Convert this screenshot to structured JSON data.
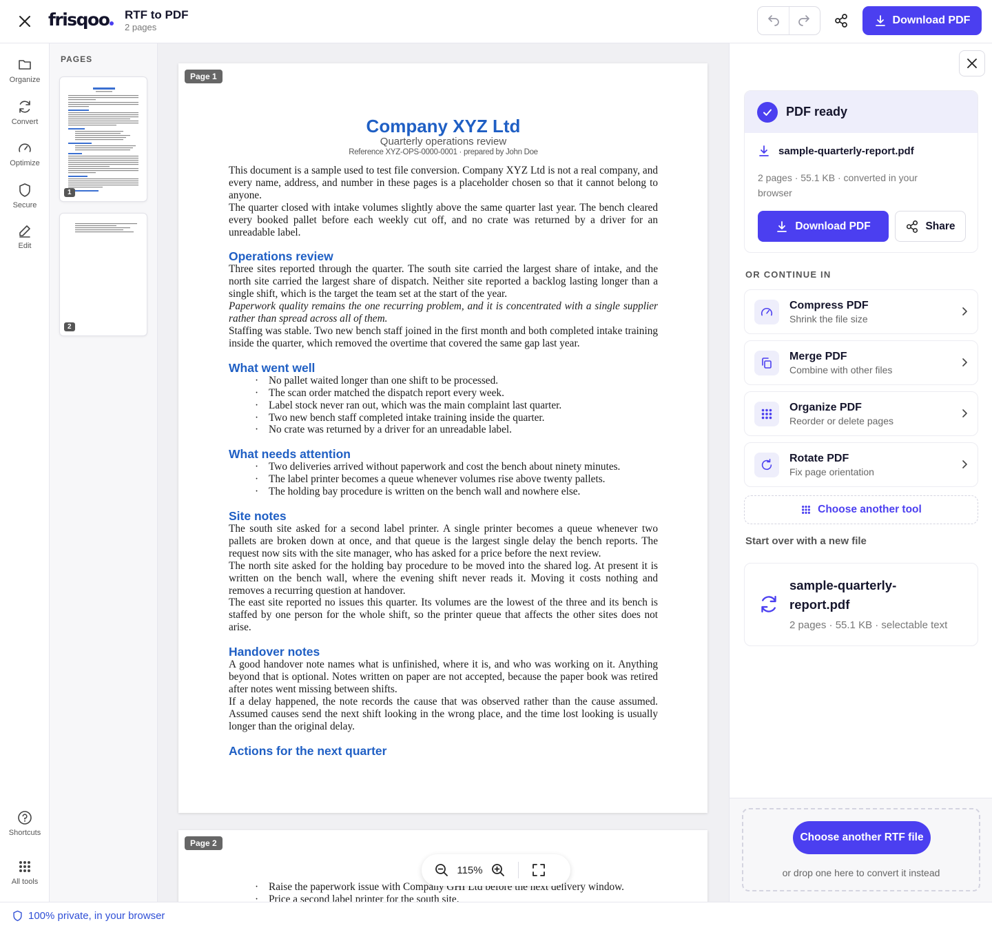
{
  "header": {
    "logo": "frisqoo",
    "title": "RTF to PDF",
    "subtitle": "2 pages",
    "download_label": "Download PDF"
  },
  "rail": {
    "items": [
      {
        "label": "Organize",
        "icon": "folder-icon"
      },
      {
        "label": "Convert",
        "icon": "refresh-icon"
      },
      {
        "label": "Optimize",
        "icon": "gauge-icon"
      },
      {
        "label": "Secure",
        "icon": "shield-icon"
      },
      {
        "label": "Edit",
        "icon": "pencil-icon"
      }
    ],
    "bottom": [
      {
        "label": "Shortcuts",
        "icon": "help-circle-icon"
      },
      {
        "label": "All tools",
        "icon": "grid-icon"
      }
    ]
  },
  "pages_panel": {
    "label": "PAGES",
    "thumbs": [
      "1",
      "2"
    ]
  },
  "document": {
    "page1_tag": "Page 1",
    "page2_tag": "Page 2",
    "company": "Company XYZ Ltd",
    "subtitle": "Quarterly operations review",
    "reference": "Reference XYZ-OPS-0000-0001 · prepared by John Doe",
    "intro1": "This document is a sample used to test file conversion. Company XYZ Ltd is not a real company, and every name, address, and number in these pages is a placeholder chosen so that it cannot belong to anyone.",
    "intro2": "The quarter closed with intake volumes slightly above the same quarter last year. The bench cleared every booked pallet before each weekly cut off, and no crate was returned by a driver for an unreadable label.",
    "ops_heading": "Operations review",
    "ops1": "Three sites reported through the quarter. The south site carried the largest share of intake, and the north site carried the largest share of dispatch. Neither site reported a backlog lasting longer than a single shift, which is the target the team set at the start of the year.",
    "ops2": "Paperwork quality remains the one recurring problem, and it is concentrated with a single supplier rather than spread across all of them.",
    "ops3": "Staffing was stable. Two new bench staff joined in the first month and both completed intake training inside the quarter, which removed the overtime that covered the same gap last year.",
    "well_heading": "What went well",
    "well_items": [
      "No pallet waited longer than one shift to be processed.",
      "The scan order matched the dispatch report every week.",
      "Label stock never ran out, which was the main complaint last quarter.",
      "Two new bench staff completed intake training inside the quarter.",
      "No crate was returned by a driver for an unreadable label."
    ],
    "attention_heading": "What needs attention",
    "attention_items": [
      "Two deliveries arrived without paperwork and cost the bench about ninety minutes.",
      "The label printer becomes a queue whenever volumes rise above twenty pallets.",
      "The holding bay procedure is written on the bench wall and nowhere else."
    ],
    "site_heading": "Site notes",
    "site1": "The south site asked for a second label printer. A single printer becomes a queue whenever two pallets are broken down at once, and that queue is the largest single delay the bench reports. The request now sits with the site manager, who has asked for a price before the next review.",
    "site2": "The north site asked for the holding bay procedure to be moved into the shared log. At present it is written on the bench wall, where the evening shift never reads it. Moving it costs nothing and removes a recurring question at handover.",
    "site3": "The east site reported no issues this quarter. Its volumes are the lowest of the three and its bench is staffed by one person for the whole shift, so the printer queue that affects the other sites does not arise.",
    "handover_heading": "Handover notes",
    "handover1": "A good handover note names what is unfinished, where it is, and who was working on it. Anything beyond that is optional. Notes written on paper are not accepted, because the paper book was retired after notes went missing between shifts.",
    "handover2": "If a delay happened, the note records the cause that was observed rather than the cause assumed. Assumed causes send the next shift looking in the wrong place, and the time lost looking is usually longer than the original delay.",
    "actions_heading": "Actions for the next quarter",
    "page2_items": [
      "Raise the paperwork issue with Company GHI Ltd before the next delivery window.",
      "Price a second label printer for the south site."
    ]
  },
  "zoom": {
    "value": "115%"
  },
  "right_panel": {
    "ready_title": "PDF ready",
    "file_name": "sample-quarterly-report.pdf",
    "file_meta": "2 pages · 55.1 KB · converted in your browser",
    "download_label": "Download PDF",
    "share_label": "Share",
    "or_label": "OR CONTINUE IN",
    "tools": [
      {
        "name": "Compress PDF",
        "desc": "Shrink the file size",
        "icon": "gauge-icon"
      },
      {
        "name": "Merge PDF",
        "desc": "Combine with other files",
        "icon": "copy-icon"
      },
      {
        "name": "Organize PDF",
        "desc": "Reorder or delete pages",
        "icon": "grid-icon"
      },
      {
        "name": "Rotate PDF",
        "desc": "Fix page orientation",
        "icon": "rotate-icon"
      }
    ],
    "choose_tool": "Choose another tool",
    "start_over": "Start over with a new file",
    "new_file_name": "sample-quarterly-report.pdf",
    "new_file_meta": "2 pages · 55.1 KB · selectable text",
    "choose_another": "Choose another RTF file",
    "drop_hint": "or drop one here to convert it instead"
  },
  "footer": {
    "text": "100% private, in your browser"
  },
  "colors": {
    "accent": "#4b3ff0",
    "heading_blue": "#1f5fc4",
    "footer_blue": "#2f4fd6"
  }
}
